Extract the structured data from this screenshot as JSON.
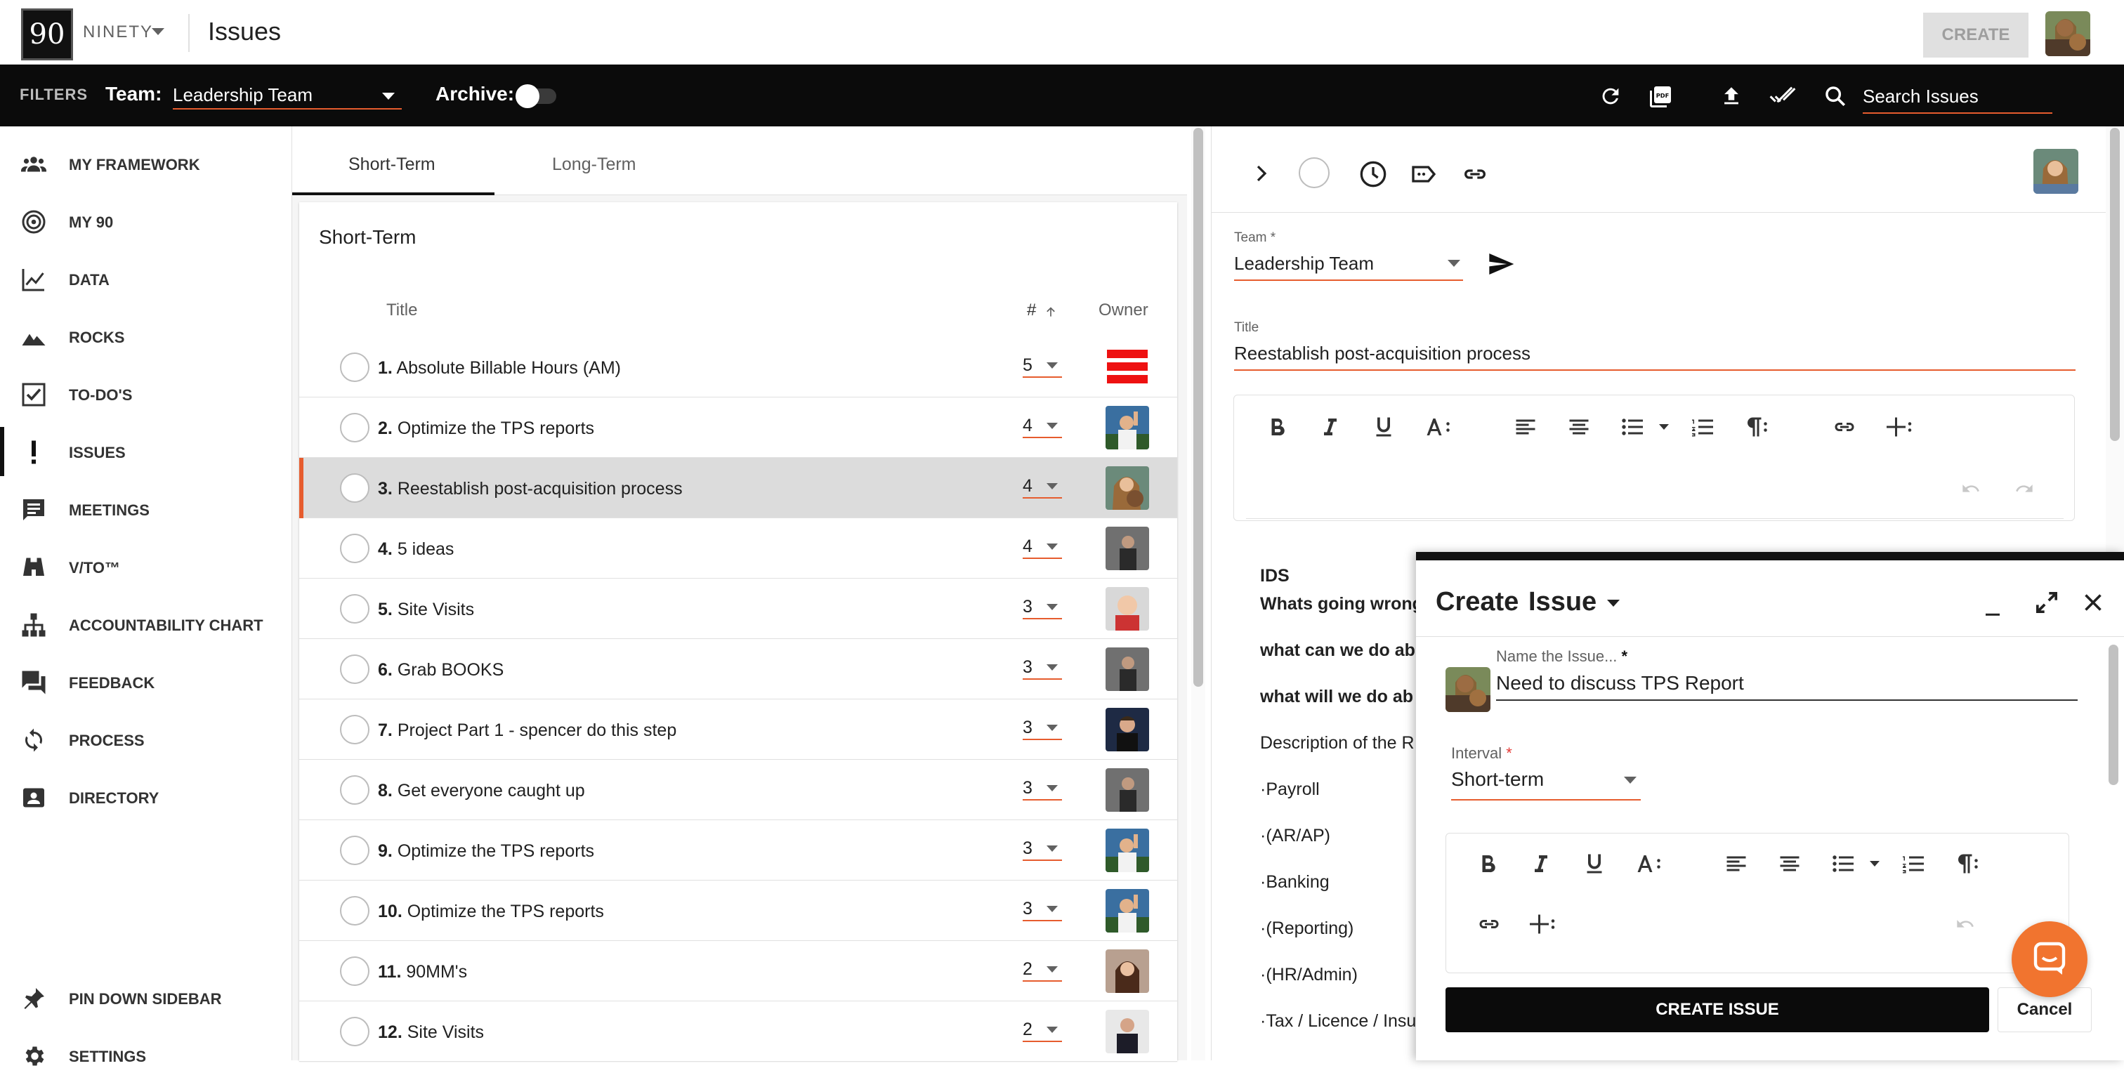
{
  "topbar": {
    "logo_text": "90",
    "brand": "NINETY",
    "page_title": "Issues",
    "create_label": "CREATE"
  },
  "filters": {
    "label": "FILTERS",
    "team_label": "Team:",
    "team_value": "Leadership Team",
    "archive_label": "Archive:",
    "archive_on": false,
    "search_placeholder": "Search Issues"
  },
  "sidebar": {
    "items": [
      {
        "label": "MY FRAMEWORK",
        "icon": "people-icon"
      },
      {
        "label": "MY 90",
        "icon": "target-icon"
      },
      {
        "label": "DATA",
        "icon": "line-chart-icon"
      },
      {
        "label": "ROCKS",
        "icon": "mountain-icon"
      },
      {
        "label": "TO-DO'S",
        "icon": "checkbox-icon"
      },
      {
        "label": "ISSUES",
        "icon": "exclamation-icon"
      },
      {
        "label": "MEETINGS",
        "icon": "message-icon"
      },
      {
        "label": "V/TO™",
        "icon": "binoculars-icon"
      },
      {
        "label": "ACCOUNTABILITY CHART",
        "icon": "org-chart-icon"
      },
      {
        "label": "FEEDBACK",
        "icon": "chat-bubbles-icon"
      },
      {
        "label": "PROCESS",
        "icon": "refresh-icon"
      },
      {
        "label": "DIRECTORY",
        "icon": "contact-card-icon"
      }
    ],
    "pin_label": "PIN DOWN SIDEBAR",
    "settings_label": "SETTINGS"
  },
  "main": {
    "tabs": [
      {
        "label": "Short-Term"
      },
      {
        "label": "Long-Term"
      }
    ],
    "card_title": "Short-Term",
    "columns": {
      "title": "Title",
      "num": "#",
      "owner": "Owner"
    },
    "rows": [
      {
        "n": "1",
        "title": "Absolute Billable Hours (AM)",
        "priority": "5",
        "owner": "red"
      },
      {
        "n": "2",
        "title": "Optimize the TPS reports",
        "priority": "4",
        "owner": "blue"
      },
      {
        "n": "3",
        "title": "Reestablish post-acquisition process",
        "priority": "4",
        "owner": "woman"
      },
      {
        "n": "4",
        "title": "5 ideas",
        "priority": "4",
        "owner": "gray"
      },
      {
        "n": "5",
        "title": "Site Visits",
        "priority": "3",
        "owner": "baby"
      },
      {
        "n": "6",
        "title": "Grab BOOKS",
        "priority": "3",
        "owner": "gray"
      },
      {
        "n": "7",
        "title": "Project Part 1 - spencer do this step",
        "priority": "3",
        "owner": "dark"
      },
      {
        "n": "8",
        "title": "Get everyone caught up",
        "priority": "3",
        "owner": "gray"
      },
      {
        "n": "9",
        "title": "Optimize the TPS reports",
        "priority": "3",
        "owner": "blue"
      },
      {
        "n": "10",
        "title": "Optimize the TPS reports",
        "priority": "3",
        "owner": "blue"
      },
      {
        "n": "11",
        "title": "90MM's",
        "priority": "2",
        "owner": "woman2"
      },
      {
        "n": "12",
        "title": "Site Visits",
        "priority": "2",
        "owner": "suit"
      }
    ]
  },
  "detail": {
    "team_label": "Team *",
    "team_value": "Leadership Team",
    "title_label": "Title",
    "title_value": "Reestablish post-acquisition process",
    "body": [
      {
        "text": "IDS",
        "bold": true
      },
      {
        "text": "Whats going wrong",
        "bold": true
      },
      {
        "text": "what can we do ab",
        "bold": true
      },
      {
        "text": "what will we do ab",
        "bold": true
      },
      {
        "text": "Description of the R",
        "bold": false
      },
      {
        "text": "·Payroll",
        "bold": false
      },
      {
        "text": "·(AR/AP)",
        "bold": false
      },
      {
        "text": "·Banking",
        "bold": false
      },
      {
        "text": "·(Reporting)",
        "bold": false
      },
      {
        "text": "·(HR/Admin)",
        "bold": false
      },
      {
        "text": "·Tax / Licence / Insu",
        "bold": false
      }
    ]
  },
  "dialog": {
    "title": "Create",
    "type": "Issue",
    "name_label": "Name the Issue...",
    "name_required": "*",
    "name_value": "Need to discuss TPS Report",
    "interval_label": "Interval",
    "interval_required": "*",
    "interval_value": "Short-term",
    "create_label": "CREATE ISSUE",
    "cancel_label": "Cancel"
  },
  "colors": {
    "accent": "#e65c2e",
    "dark": "#0b0b0b",
    "chat": "#f1742f"
  }
}
